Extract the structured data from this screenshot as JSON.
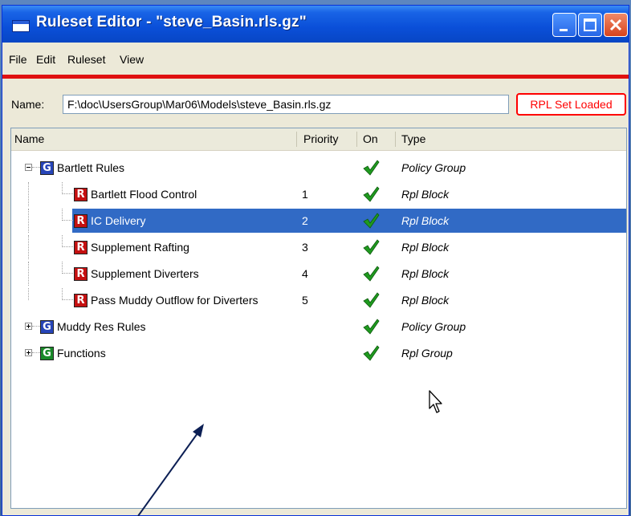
{
  "window": {
    "title": "Ruleset Editor - \"steve_Basin.rls.gz\"",
    "buttons": {
      "minimize_icon": "minimize-icon",
      "maximize_icon": "maximize-icon",
      "close_icon": "close-icon"
    }
  },
  "menu": [
    "File",
    "Edit",
    "Ruleset",
    "View"
  ],
  "name_field": {
    "label": "Name:",
    "value": "F:\\doc\\UsersGroup\\Mar06\\Models\\steve_Basin.rls.gz"
  },
  "status_badge": "RPL Set Loaded",
  "tree": {
    "columns": [
      "Name",
      "Priority",
      "On",
      "Type"
    ],
    "rows": [
      {
        "name": "Bartlett Rules",
        "priority": "",
        "on": true,
        "type": "Policy Group",
        "icon": "G",
        "level": 0,
        "expanded": true
      },
      {
        "name": "Bartlett Flood Control",
        "priority": "1",
        "on": true,
        "type": "Rpl Block",
        "icon": "R",
        "level": 1
      },
      {
        "name": "IC Delivery",
        "priority": "2",
        "on": true,
        "type": "Rpl Block",
        "icon": "R",
        "level": 1,
        "selected": true
      },
      {
        "name": "Supplement Rafting",
        "priority": "3",
        "on": true,
        "type": "Rpl Block",
        "icon": "R",
        "level": 1
      },
      {
        "name": "Supplement Diverters",
        "priority": "4",
        "on": true,
        "type": "Rpl Block",
        "icon": "R",
        "level": 1
      },
      {
        "name": "Pass Muddy Outflow for Diverters",
        "priority": "5",
        "on": true,
        "type": "Rpl Block",
        "icon": "R",
        "level": 1
      },
      {
        "name": "Muddy Res Rules",
        "priority": "",
        "on": true,
        "type": "Policy Group",
        "icon": "G",
        "level": 0,
        "expanded": false
      },
      {
        "name": "Functions",
        "priority": "",
        "on": true,
        "type": "Rpl Group",
        "icon": "G",
        "level": 0,
        "expanded": false
      }
    ]
  },
  "colors": {
    "selection": "#316ac5",
    "status_red": "#ff0000",
    "check_green": "#1f9a1f"
  }
}
